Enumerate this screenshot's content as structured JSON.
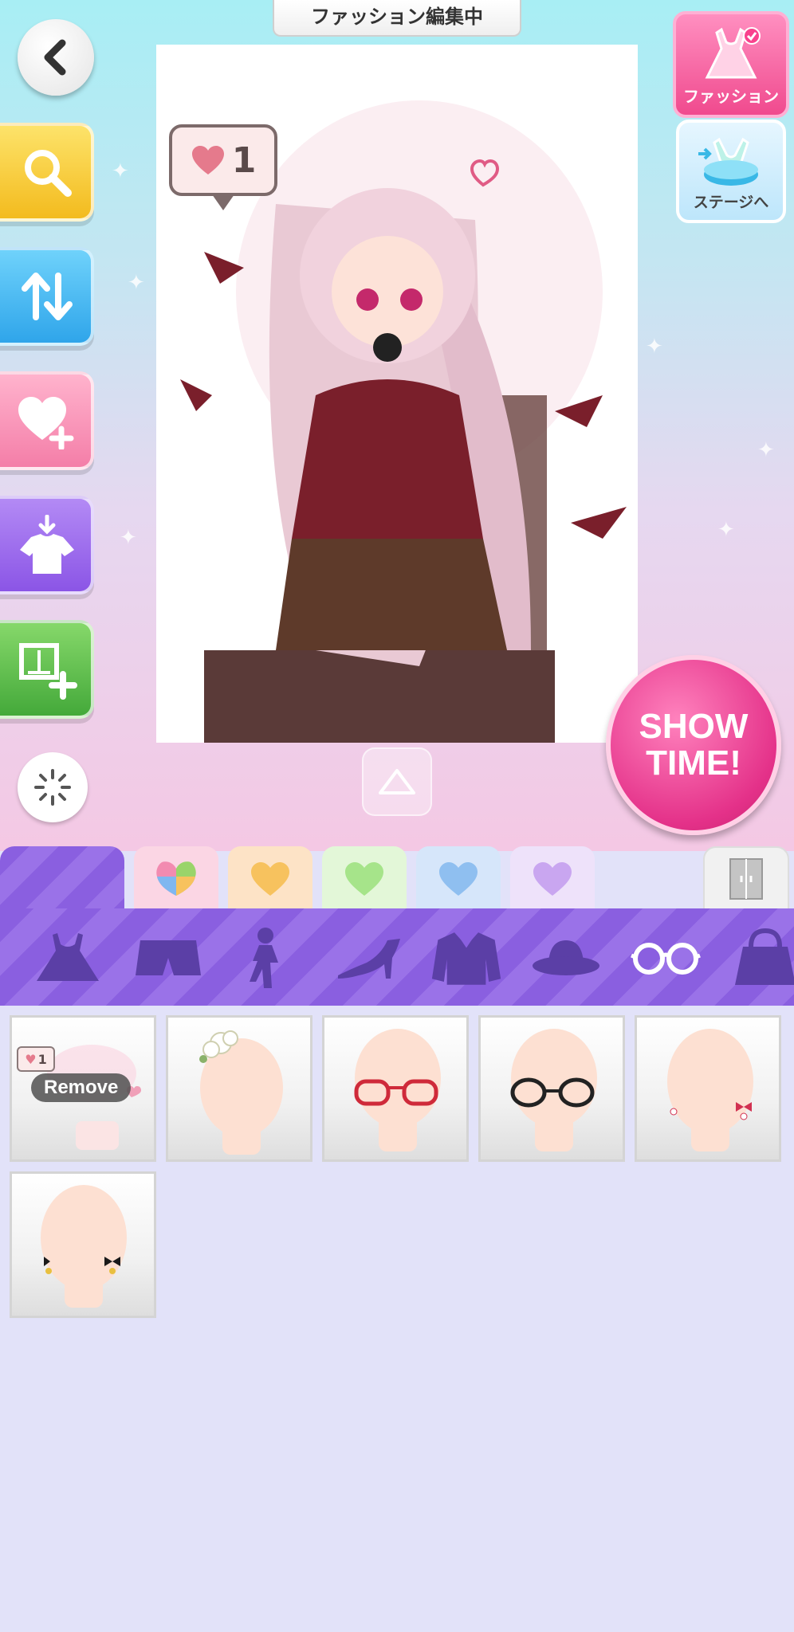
{
  "header": {
    "title": "ファッション編集中"
  },
  "right_tabs": {
    "fashion_label": "ファッション",
    "stage_label": "ステージへ"
  },
  "preview": {
    "like_count": "1"
  },
  "showtime": {
    "line1": "SHOW",
    "line2": "TIME!"
  },
  "filter_tabs": [
    {
      "name": "all",
      "color": "#8a5fe0"
    },
    {
      "name": "multi",
      "color": "#fbd6e4"
    },
    {
      "name": "orange",
      "color": "#fde3c6"
    },
    {
      "name": "green",
      "color": "#e3f7d8"
    },
    {
      "name": "blue",
      "color": "#d6e6fa"
    },
    {
      "name": "purple",
      "color": "#eee2fa"
    }
  ],
  "categories": [
    "dress-icon",
    "shorts-icon",
    "pose-icon",
    "heel-icon",
    "jacket-icon",
    "hat-icon",
    "glasses-icon",
    "bag-icon"
  ],
  "items": {
    "remove_label": "Remove",
    "mini_like_count": "1"
  },
  "colors": {
    "accent_purple": "#8a5fe0",
    "accent_pink": "#e43189"
  }
}
